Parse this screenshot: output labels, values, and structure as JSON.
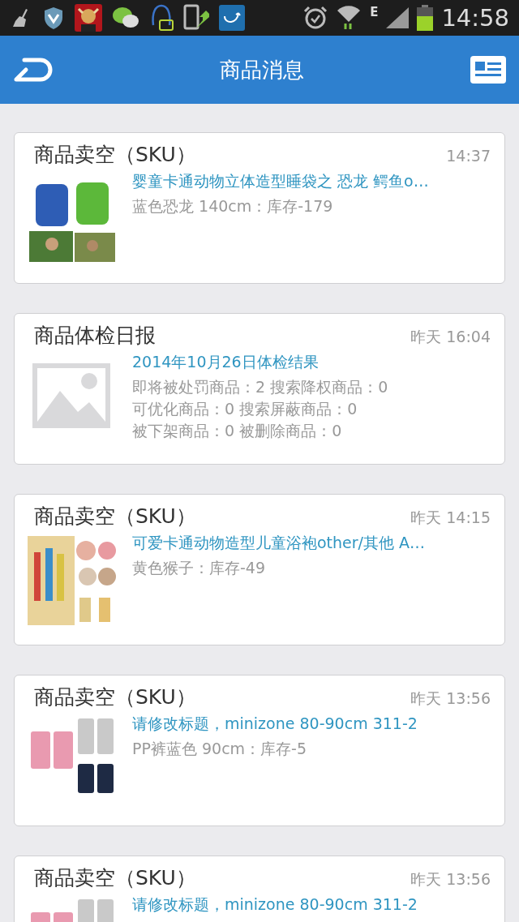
{
  "status_bar": {
    "network_type": "E",
    "time": "14:58"
  },
  "header": {
    "title": "商品消息"
  },
  "messages": [
    {
      "title": "商品卖空（SKU）",
      "time": "14:37",
      "link": "婴童卡通动物立体造型睡袋之 恐龙 鳄鱼o…",
      "details": [
        "蓝色恐龙 140cm：库存-179"
      ]
    },
    {
      "title": "商品体检日报",
      "time": "昨天 16:04",
      "image": {
        "kind": "placeholder"
      },
      "link": "2014年10月26日体检结果",
      "details": [
        "即将被处罚商品：2 搜索降权商品：0",
        "可优化商品：0 搜索屏蔽商品：0",
        "被下架商品：0 被删除商品：0"
      ]
    },
    {
      "title": "商品卖空（SKU）",
      "time": "昨天 14:15",
      "link": "可爱卡通动物造型儿童浴袍other/其他 A…",
      "details": [
        "黄色猴子：库存-49"
      ]
    },
    {
      "title": "商品卖空（SKU）",
      "time": "昨天 13:56",
      "link": "请修改标题，minizone 80-90cm 311-2",
      "details": [
        "PP裤蓝色 90cm：库存-5"
      ]
    },
    {
      "title": "商品卖空（SKU）",
      "time": "昨天 13:56",
      "link": "请修改标题，minizone 80-90cm 311-2"
    }
  ]
}
